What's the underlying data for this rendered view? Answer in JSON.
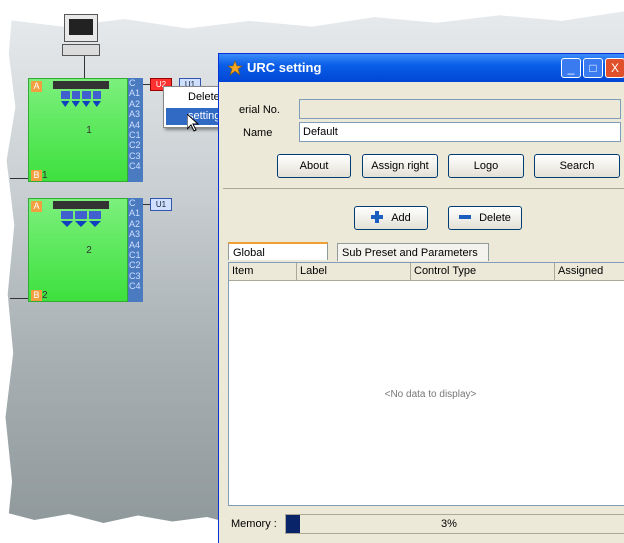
{
  "devices": [
    {
      "number": "1",
      "caption": "1",
      "tag_top": "A",
      "tag_bottom": "B",
      "ports": [
        "C",
        "A1",
        "A2",
        "A3",
        "A4",
        "C1",
        "C2",
        "C3",
        "C4"
      ],
      "buttons": [
        "U2",
        "U1"
      ]
    },
    {
      "number": "2",
      "caption": "2",
      "tag_top": "A",
      "tag_bottom": "B",
      "ports": [
        "C",
        "A1",
        "A2",
        "A3",
        "A4",
        "C1",
        "C2",
        "C3",
        "C4"
      ],
      "buttons": [
        "U1"
      ]
    }
  ],
  "context_menu": {
    "items": [
      "Delete",
      "settings"
    ],
    "selected": "settings"
  },
  "window": {
    "title": "URC setting",
    "controls": {
      "minimize": "_",
      "maximize": "□",
      "close": "X"
    },
    "serial_label": "erial No.",
    "serial_value": "",
    "name_label": "Name",
    "name_value": "Default",
    "buttons": {
      "about": "About",
      "assign_right": "Assign right",
      "logo": "Logo",
      "search": "Search"
    },
    "add_label": "Add",
    "delete_label": "Delete",
    "tabs": [
      "Global Parameters",
      "Sub Preset and Parameters"
    ],
    "columns": [
      "Item",
      "Label",
      "Control Type",
      "Assigned"
    ],
    "empty_text": "<No data to display>",
    "memory_label": "Memory :",
    "memory_value": "3%",
    "memory_fraction": 0.03
  },
  "colors": {
    "titlebar": "#0a5ee8",
    "device_green": "#3ee03e",
    "selection": "#316ac5"
  }
}
